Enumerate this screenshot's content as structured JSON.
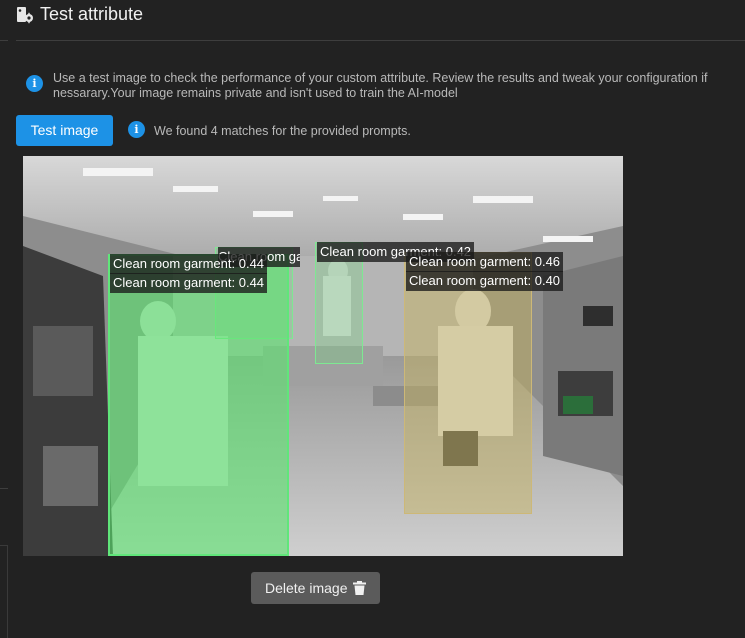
{
  "header": {
    "title": "Test attribute",
    "icon": "tag-gear-icon"
  },
  "info": {
    "description": "Use a test image to check the performance of your custom attribute. Review the results and tweak your configuration if nessarary.Your image remains private and isn't used to train the AI-model",
    "icon_glyph": "i"
  },
  "actions": {
    "test_image_label": "Test image",
    "delete_image_label": "Delete image"
  },
  "result": {
    "match_text": "We found 4 matches for the provided prompts."
  },
  "detections": [
    {
      "label": "Clean room garment: 0.44"
    },
    {
      "label": "Clean room garment: 0.44"
    },
    {
      "label": "Clean room garment: 0.46"
    },
    {
      "label": "Clean room garment: 0.40"
    },
    {
      "label": "Clean room garment: 0.43"
    },
    {
      "label": "Clean room garment: 0.42"
    }
  ],
  "colors": {
    "accent": "#1d92e6",
    "background": "#222222",
    "detection_green": "#60e67a",
    "detection_yellow": "#cdb877"
  }
}
